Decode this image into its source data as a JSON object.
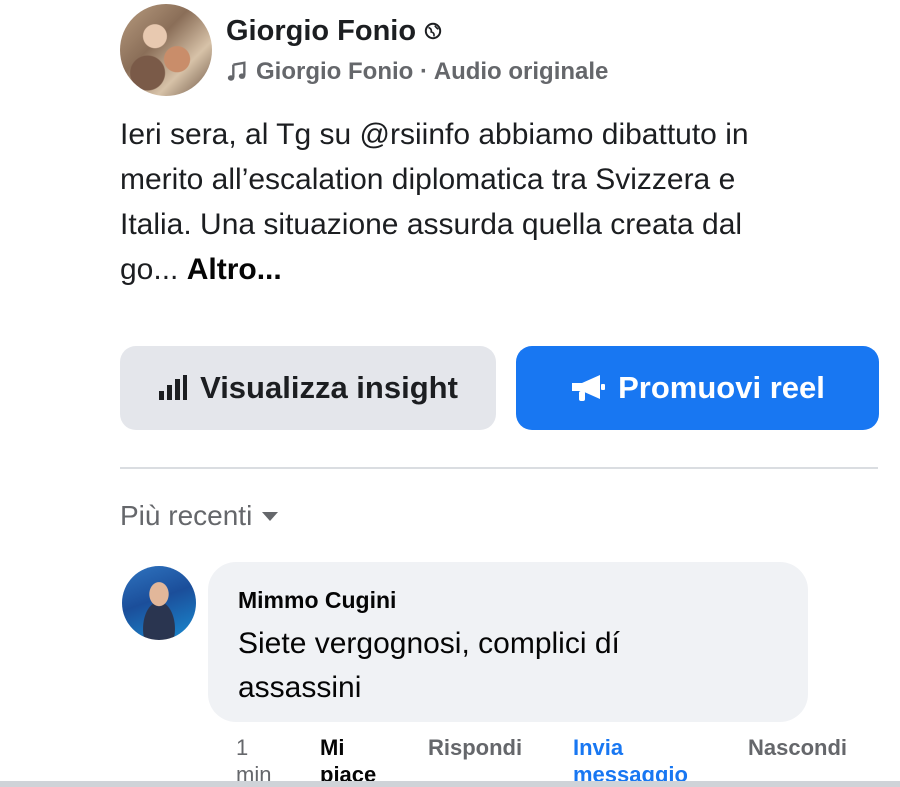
{
  "post": {
    "author": "Giorgio Fonio",
    "audio": "Giorgio Fonio · Audio originale",
    "text_line1": "Ieri sera, al Tg su @rsiinfo abbiamo dibattuto in",
    "text_line2": "merito all’escalation diplomatica tra Svizzera e",
    "text_line3": "Italia. Una situazione assurda quella creata dal",
    "text_line4": "go...",
    "more": "Altro..."
  },
  "buttons": {
    "insight": "Visualizza insight",
    "promote": "Promuovi reel"
  },
  "sort": {
    "label": "Più recenti"
  },
  "comment": {
    "author": "Mimmo Cugini",
    "text_line1": "Siete vergognosi, complici dí",
    "text_line2": "assassini",
    "time_line1": "1",
    "time_line2": "min",
    "like_line1": "Mi",
    "like_line2": "piace",
    "reply": "Rispondi",
    "message_line1": "Invia",
    "message_line2": "messaggio",
    "hide": "Nascondi"
  },
  "icons": {
    "privacy": "globe-icon",
    "audio": "music-note-icon",
    "insight": "bar-chart-icon",
    "promote": "megaphone-icon",
    "sort": "caret-down-icon"
  },
  "colors": {
    "accent": "#1877f2",
    "secondary_text": "#65676b",
    "button_gray": "#e4e6eb",
    "bubble": "#f0f2f5"
  }
}
